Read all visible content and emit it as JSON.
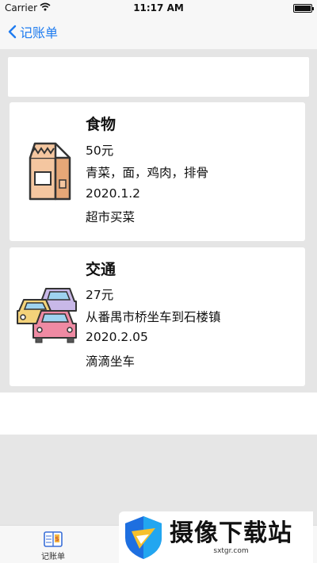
{
  "status_bar": {
    "carrier": "Carrier",
    "time": "11:17 AM"
  },
  "nav": {
    "back_label": "记账单"
  },
  "records": [
    {
      "title": "食物",
      "amount": "50元",
      "items": "青菜，面，鸡肉，排骨",
      "date": "2020.1.2",
      "note": "超市买菜",
      "icon": "food-bag-icon"
    },
    {
      "title": "交通",
      "amount": "27元",
      "items": "从番禺市桥坐车到石楼镇",
      "date": "2020.2.05",
      "note": "滴滴坐车",
      "icon": "traffic-cars-icon"
    }
  ],
  "tab_bar": {
    "items": [
      {
        "label": "记账单",
        "icon": "ledger-icon"
      }
    ]
  },
  "watermark": {
    "title": "摄像下载站",
    "url": "sxtgr.com"
  },
  "colors": {
    "accent": "#1f7cf0",
    "background": "#e5e5e5"
  }
}
